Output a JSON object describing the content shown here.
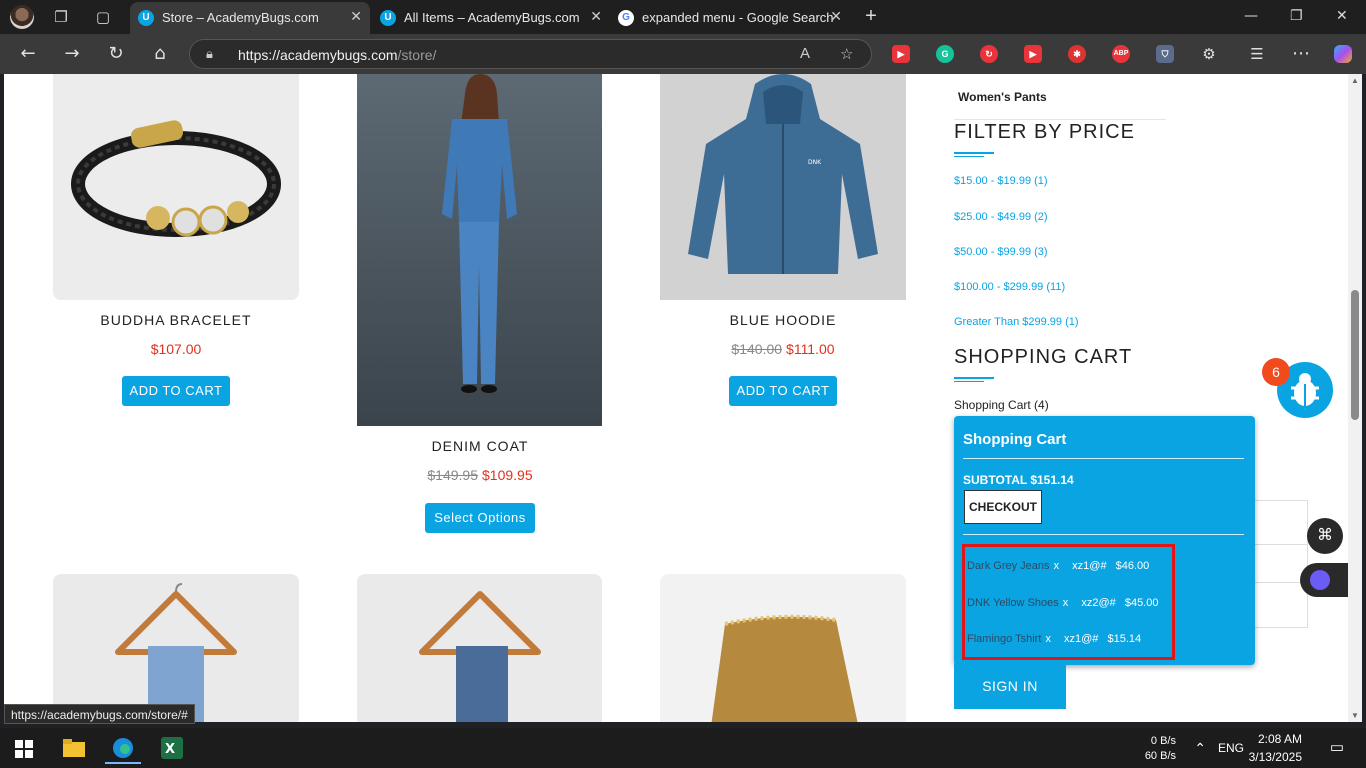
{
  "browser": {
    "tabs": [
      {
        "title": "Store – AcademyBugs.com",
        "favicon": "U",
        "active": true
      },
      {
        "title": "All Items – AcademyBugs.com",
        "favicon": "U",
        "active": false
      },
      {
        "title": "expanded menu - Google Search",
        "favicon": "G",
        "active": false
      }
    ],
    "url_host": "https://academybugs.com",
    "url_path": "/store/",
    "status_url": "https://academybugs.com/store/#"
  },
  "products_row1": [
    {
      "name": "BUDDHA BRACELET",
      "old_price": "",
      "price": "$107.00",
      "button": "ADD TO CART"
    },
    {
      "name": "DENIM COAT",
      "old_price": "$149.95",
      "price": "$109.95",
      "button": "Select Options"
    },
    {
      "name": "BLUE HOODIE",
      "old_price": "$140.00",
      "price": "$111.00",
      "button": "ADD TO CART"
    }
  ],
  "sidebar": {
    "category_last": "Women's Pants",
    "filter_title": "FILTER BY PRICE",
    "price_ranges": [
      "$15.00 - $19.99 (1)",
      "$25.00 - $49.99 (2)",
      "$50.00 - $99.99 (3)",
      "$100.00 - $299.99 (11)",
      "Greater Than $299.99 (1)"
    ],
    "cart_title": "SHOPPING CART",
    "cart_link": "Shopping Cart (4)",
    "sign_in": "SIGN IN"
  },
  "cart_popup": {
    "title": "Shopping Cart",
    "subtotal": "SUBTOTAL $151.14",
    "checkout": "CHECKOUT",
    "items": [
      {
        "name": "Dark Grey Jeans",
        "remove": "x",
        "qty": "xz1@#",
        "price": "$46.00"
      },
      {
        "name": "DNK Yellow Shoes",
        "remove": "x",
        "qty": "xz2@#",
        "price": "$45.00"
      },
      {
        "name": "Flamingo Tshirt",
        "remove": "x",
        "qty": "xz1@#",
        "price": "$15.14"
      }
    ]
  },
  "bug_count": "6",
  "taskbar": {
    "net_up": "0 B/s",
    "net_down": "60 B/s",
    "lang": "ENG",
    "time": "2:08 AM",
    "date": "3/13/2025"
  }
}
